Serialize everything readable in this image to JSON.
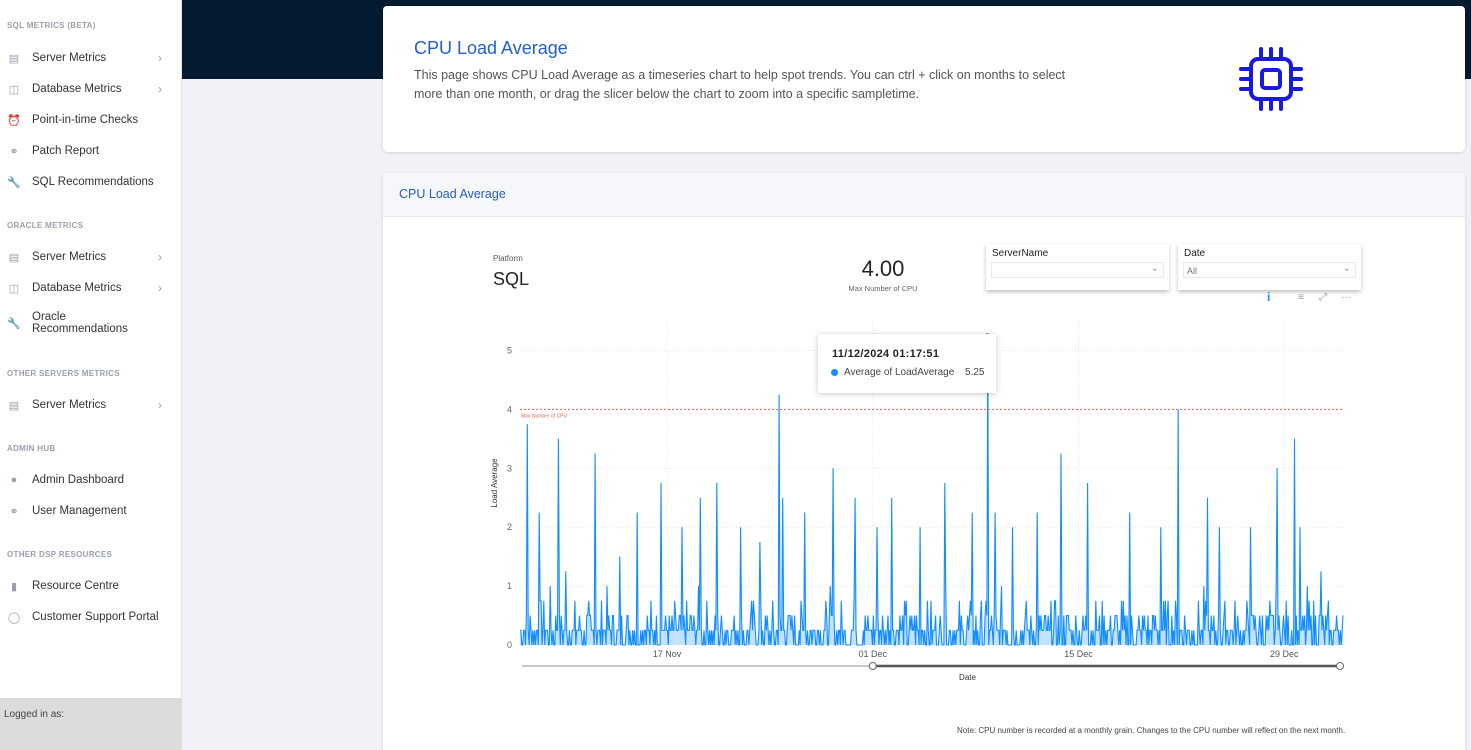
{
  "sidebar": {
    "sections": [
      {
        "heading": "SQL METRICS (BETA)",
        "items": [
          {
            "label": "Server Metrics",
            "icon": "server-icon",
            "chevron": true
          },
          {
            "label": "Database Metrics",
            "icon": "database-icon",
            "chevron": true
          },
          {
            "label": "Point-in-time Checks",
            "icon": "alarm-clock-icon",
            "chevron": false
          },
          {
            "label": "Patch Report",
            "icon": "bandage-icon",
            "chevron": false
          },
          {
            "label": "SQL Recommendations",
            "icon": "wrench-icon",
            "chevron": false
          }
        ]
      },
      {
        "heading": "ORACLE METRICS",
        "items": [
          {
            "label": "Server Metrics",
            "icon": "server-icon",
            "chevron": true
          },
          {
            "label": "Database Metrics",
            "icon": "database-icon",
            "chevron": true
          },
          {
            "label": "Oracle Recommendations",
            "icon": "wrench-icon",
            "chevron": false
          }
        ]
      },
      {
        "heading": "OTHER SERVERS METRICS",
        "items": [
          {
            "label": "Server Metrics",
            "icon": "server-icon",
            "chevron": true
          }
        ]
      },
      {
        "heading": "ADMIN HUB",
        "items": [
          {
            "label": "Admin Dashboard",
            "icon": "user-icon",
            "chevron": false
          },
          {
            "label": "User Management",
            "icon": "users-icon",
            "chevron": false
          }
        ]
      },
      {
        "heading": "OTHER DSP RESOURCES",
        "items": [
          {
            "label": "Resource Centre",
            "icon": "bar-chart-icon",
            "chevron": false
          },
          {
            "label": "Customer Support Portal",
            "icon": "chat-icon",
            "chevron": false
          }
        ]
      }
    ],
    "logged_in_label": "Logged in as:"
  },
  "info_card": {
    "title": "CPU Load Average",
    "description": "This page shows CPU Load Average as a timeseries chart to help spot trends. You can ctrl + click on months to select more than one month, or drag the slicer below the chart to zoom into a specific sampletime.",
    "icon": "cpu-chip-icon",
    "icon_color": "#1a1adb"
  },
  "chart_card": {
    "title": "CPU Load Average",
    "platform_label": "Platform",
    "platform_value": "SQL",
    "cpu_value": "4.00",
    "cpu_label": "Max Number of CPU",
    "slicers": [
      {
        "title": "ServerName",
        "value": ""
      },
      {
        "title": "Date",
        "value": "All"
      }
    ],
    "tools": {
      "info": "i",
      "filter": "≡",
      "focus": "⤢",
      "more": "···"
    },
    "tooltip": {
      "date": "11/12/2024 01:17:51",
      "series": "Average of LoadAverage",
      "value": "5.25"
    },
    "footnote": "Note: CPU number is recorded at a monthly grain. Changes to the CPU number will reflect on the next month."
  },
  "chart_data": {
    "type": "line",
    "title": "CPU Load Average",
    "xlabel": "Date",
    "ylabel": "Load Average",
    "ylim": [
      0,
      5.5
    ],
    "yticks": [
      0,
      1,
      2,
      3,
      4,
      5
    ],
    "x_range_days": [
      0,
      56
    ],
    "x_range_label": [
      "07 Nov 2024",
      "01 Jan 2025"
    ],
    "xticks": [
      {
        "label": "17 Nov",
        "day": 10
      },
      {
        "label": "01 Dec",
        "day": 24
      },
      {
        "label": "15 Dec",
        "day": 38
      },
      {
        "label": "29 Dec",
        "day": 52
      }
    ],
    "reference_line": {
      "label": "Max Number of CPU",
      "value": 4.0,
      "color": "#e06666"
    },
    "series_color": "#118dff",
    "grid": true,
    "series": [
      {
        "name": "Average of LoadAverage",
        "baseline_range": [
          0,
          0.75
        ],
        "peaks": [
          {
            "day": 0.5,
            "value": 3.75
          },
          {
            "day": 1.3,
            "value": 2.25
          },
          {
            "day": 2.6,
            "value": 3.5
          },
          {
            "day": 3.1,
            "value": 1.25
          },
          {
            "day": 5.1,
            "value": 3.25
          },
          {
            "day": 6.8,
            "value": 1.5
          },
          {
            "day": 8.0,
            "value": 2.25
          },
          {
            "day": 9.6,
            "value": 2.75
          },
          {
            "day": 11.0,
            "value": 2.0
          },
          {
            "day": 12.3,
            "value": 2.5
          },
          {
            "day": 13.4,
            "value": 2.75
          },
          {
            "day": 15.0,
            "value": 2.0
          },
          {
            "day": 16.3,
            "value": 1.75
          },
          {
            "day": 17.6,
            "value": 4.25
          },
          {
            "day": 17.9,
            "value": 2.5
          },
          {
            "day": 19.4,
            "value": 2.25
          },
          {
            "day": 21.3,
            "value": 3.0
          },
          {
            "day": 22.8,
            "value": 2.5
          },
          {
            "day": 24.3,
            "value": 2.0
          },
          {
            "day": 25.3,
            "value": 2.5
          },
          {
            "day": 27.2,
            "value": 2.0
          },
          {
            "day": 28.9,
            "value": 2.75
          },
          {
            "day": 30.8,
            "value": 2.25
          },
          {
            "day": 31.8,
            "value": 5.25
          },
          {
            "day": 32.3,
            "value": 2.25
          },
          {
            "day": 33.5,
            "value": 2.0
          },
          {
            "day": 35.2,
            "value": 2.25
          },
          {
            "day": 36.8,
            "value": 3.25
          },
          {
            "day": 38.6,
            "value": 2.75
          },
          {
            "day": 41.5,
            "value": 2.25
          },
          {
            "day": 43.6,
            "value": 2.0
          },
          {
            "day": 44.8,
            "value": 4.0
          },
          {
            "day": 46.8,
            "value": 2.5
          },
          {
            "day": 47.6,
            "value": 2.0
          },
          {
            "day": 49.7,
            "value": 2.0
          },
          {
            "day": 51.5,
            "value": 3.0
          },
          {
            "day": 52.7,
            "value": 3.5
          },
          {
            "day": 53.1,
            "value": 2.0
          },
          {
            "day": 54.5,
            "value": 1.25
          }
        ]
      }
    ],
    "slider": {
      "start_day": 24,
      "end_day": 56
    }
  }
}
